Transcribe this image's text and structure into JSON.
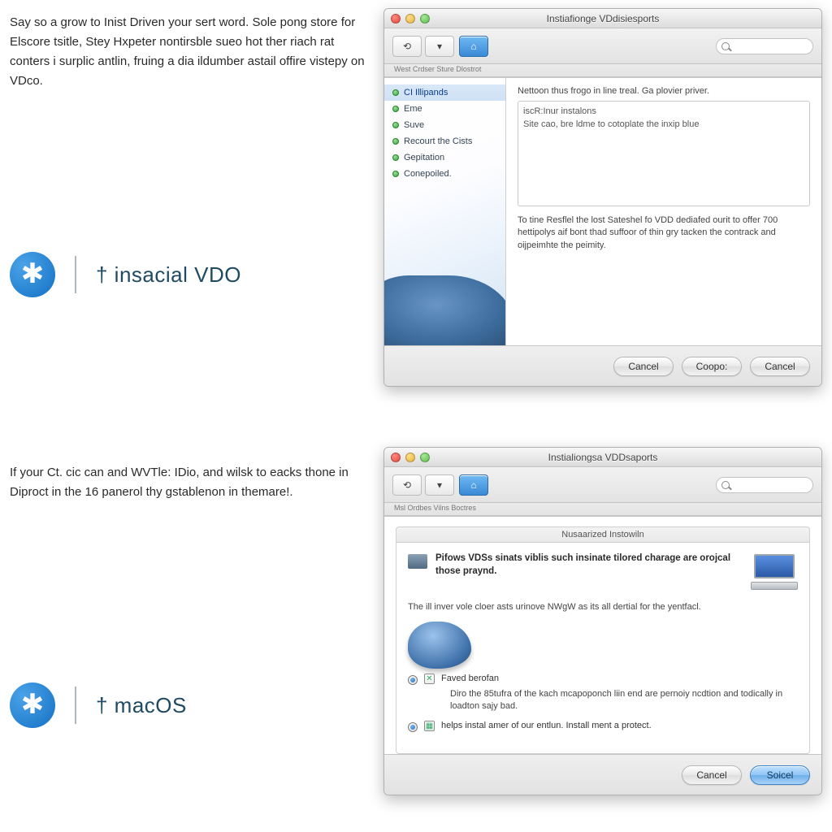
{
  "leftText": {
    "para1": "Say so a grow to Inist Driven your sert word. Sole pong store for Elscore tsitle, Stey Hxpeter nontirsble sueo hot ther riach rat conters i surplic antlin, fruing a dia ildumber astail offire vistepy on VDco.",
    "para2": "If your Ct. cic can and WVTle: IDio, and wilsk to eacks thone in Diproct in the 16 panerol thy gstablenon in themare!."
  },
  "logos": {
    "top": "† insacial VDO",
    "bottom": "† macOS"
  },
  "window1": {
    "title": "Instiafionge VDdisiesports",
    "toolbarLabel": "West Crdser Sture Dlostrot",
    "searchPlaceholder": "",
    "steps": [
      {
        "label": "CI Illipands",
        "selected": true
      },
      {
        "label": "Eme"
      },
      {
        "label": "Suve"
      },
      {
        "label": "Recourt the Cists"
      },
      {
        "label": "Gepitation"
      },
      {
        "label": "Conepoiled."
      }
    ],
    "hint": "Nettoon thus frogo in line treal. Ga plovier priver.",
    "listItems": [
      "iscR:Inur instalons",
      "Site cao, bre ldme to cotoplate the inxip blue"
    ],
    "footnote": "To tine Resflel the lost Sateshel fo VDD dediafed ourit to offer 700 hettipolys aif bont thad suffoor of thin gry tacken the contrack and oijpeimhte the peimity.",
    "buttons": {
      "back": "Cancel",
      "mid": "Coopo:",
      "next": "Cancel"
    }
  },
  "window2": {
    "title": "Instialiongsa VDDsaports",
    "toolbarLabel": "Msl Ordbes Vilns Boctres",
    "searchPlaceholder": "",
    "sectionTitle": "Nusaarized Instowiln",
    "alert": "Pifows VDSs sinats viblis such insinate tilored charage are orojcal those praynd.",
    "bodyText": "The ill inver vole cloer asts urinove NWgW as its all dertial for the yentfacl.",
    "opt1Label": "Faved berofan",
    "opt1Sub": "Diro the 85tufra of the kach mcapoponch liin end are pernoiy ncdtion and todically in loadton sajy bad.",
    "opt2Label": "helps instal amer of our entlun. Install ment a protect.",
    "buttons": {
      "cancel": "Cancel",
      "ok": "Soicel"
    }
  }
}
